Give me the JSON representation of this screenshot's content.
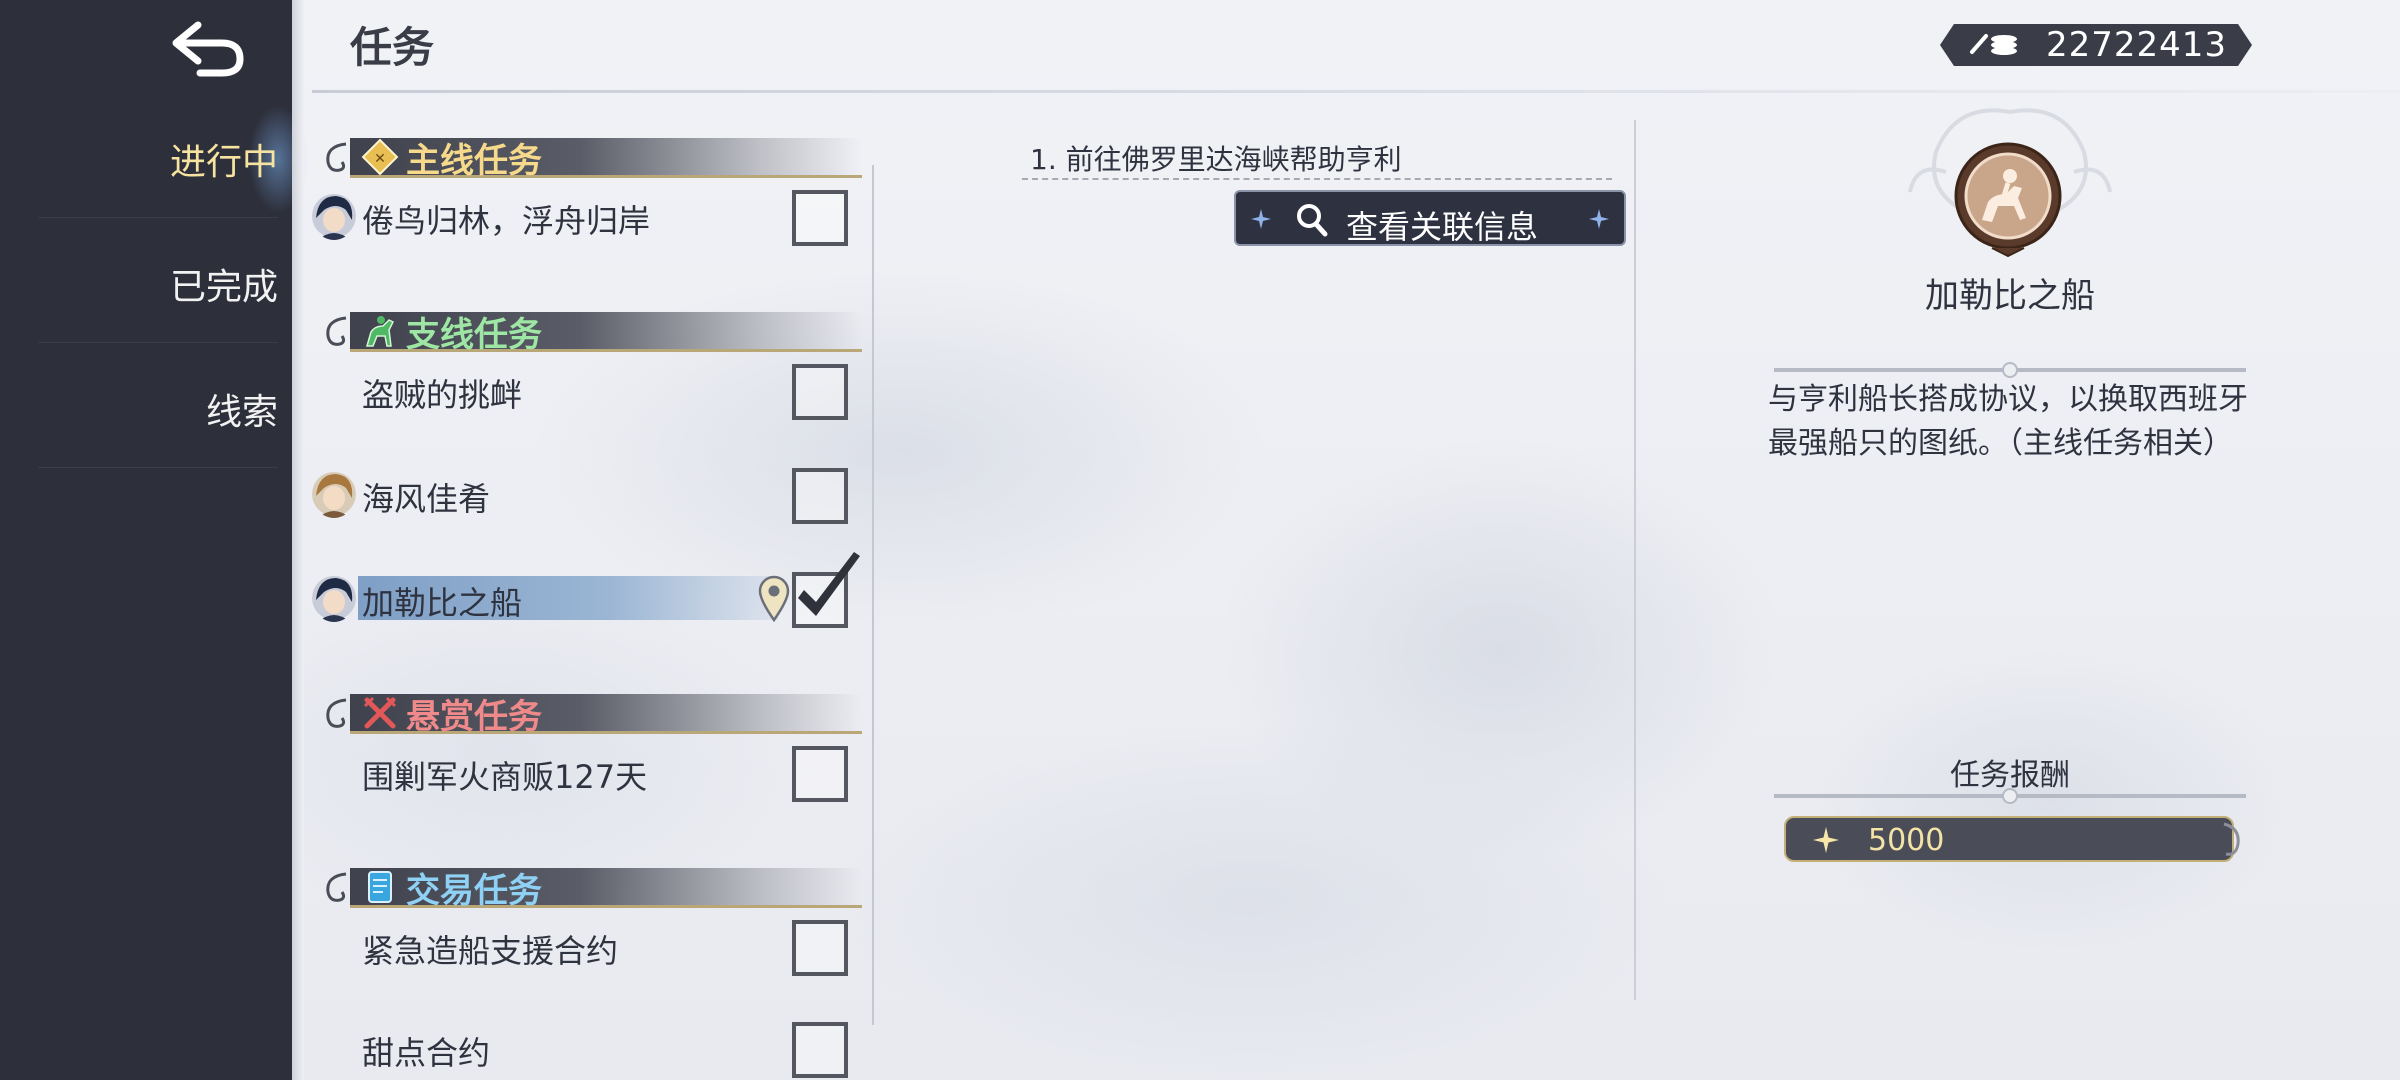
{
  "nav": {
    "back_icon": "back-arrow-icon",
    "items": [
      {
        "label": "进行中",
        "active": true
      },
      {
        "label": "已完成",
        "active": false
      },
      {
        "label": "线索",
        "active": false
      }
    ]
  },
  "header": {
    "title": "任务",
    "currency": {
      "icon": "coin-stack-icon",
      "amount": "22722413"
    }
  },
  "categories": [
    {
      "label": "主线任务",
      "color": "#f6d98a",
      "icon": "main-quest-icon",
      "quests": [
        {
          "name": "倦鸟归林，浮舟归岸",
          "avatar": true,
          "checked": false
        }
      ]
    },
    {
      "label": "支线任务",
      "color": "#9ee6a3",
      "icon": "horseman-icon",
      "quests": [
        {
          "name": "盗贼的挑衅",
          "avatar": false,
          "checked": false
        },
        {
          "name": "海风佳肴",
          "avatar": true,
          "checked": false
        },
        {
          "name": "加勒比之船",
          "avatar": true,
          "checked": true,
          "selected": true
        }
      ]
    },
    {
      "label": "悬赏任务",
      "color": "#f08a8a",
      "icon": "crossed-swords-icon",
      "quests": [
        {
          "name": "围剿军火商贩127天",
          "avatar": false,
          "checked": false
        }
      ]
    },
    {
      "label": "交易任务",
      "color": "#8fd0f5",
      "icon": "scroll-icon",
      "quests": [
        {
          "name": "紧急造船支援合约",
          "avatar": false,
          "checked": false
        },
        {
          "name": "甜点合约",
          "avatar": false,
          "checked": false
        }
      ]
    }
  ],
  "objective": {
    "text": "1.  前往佛罗里达海峡帮助亨利",
    "related_button": "查看关联信息"
  },
  "detail": {
    "emblem_icon": "horse-rider-emblem-icon",
    "title": "加勒比之船",
    "description_line1": "与亨利船长搭成协议，以换取西班牙",
    "description_line2": "最强船只的图纸。（主线任务相关）",
    "reward_title": "任务报酬",
    "reward_value": "5000",
    "reward_icon": "sparkle-star-icon"
  }
}
